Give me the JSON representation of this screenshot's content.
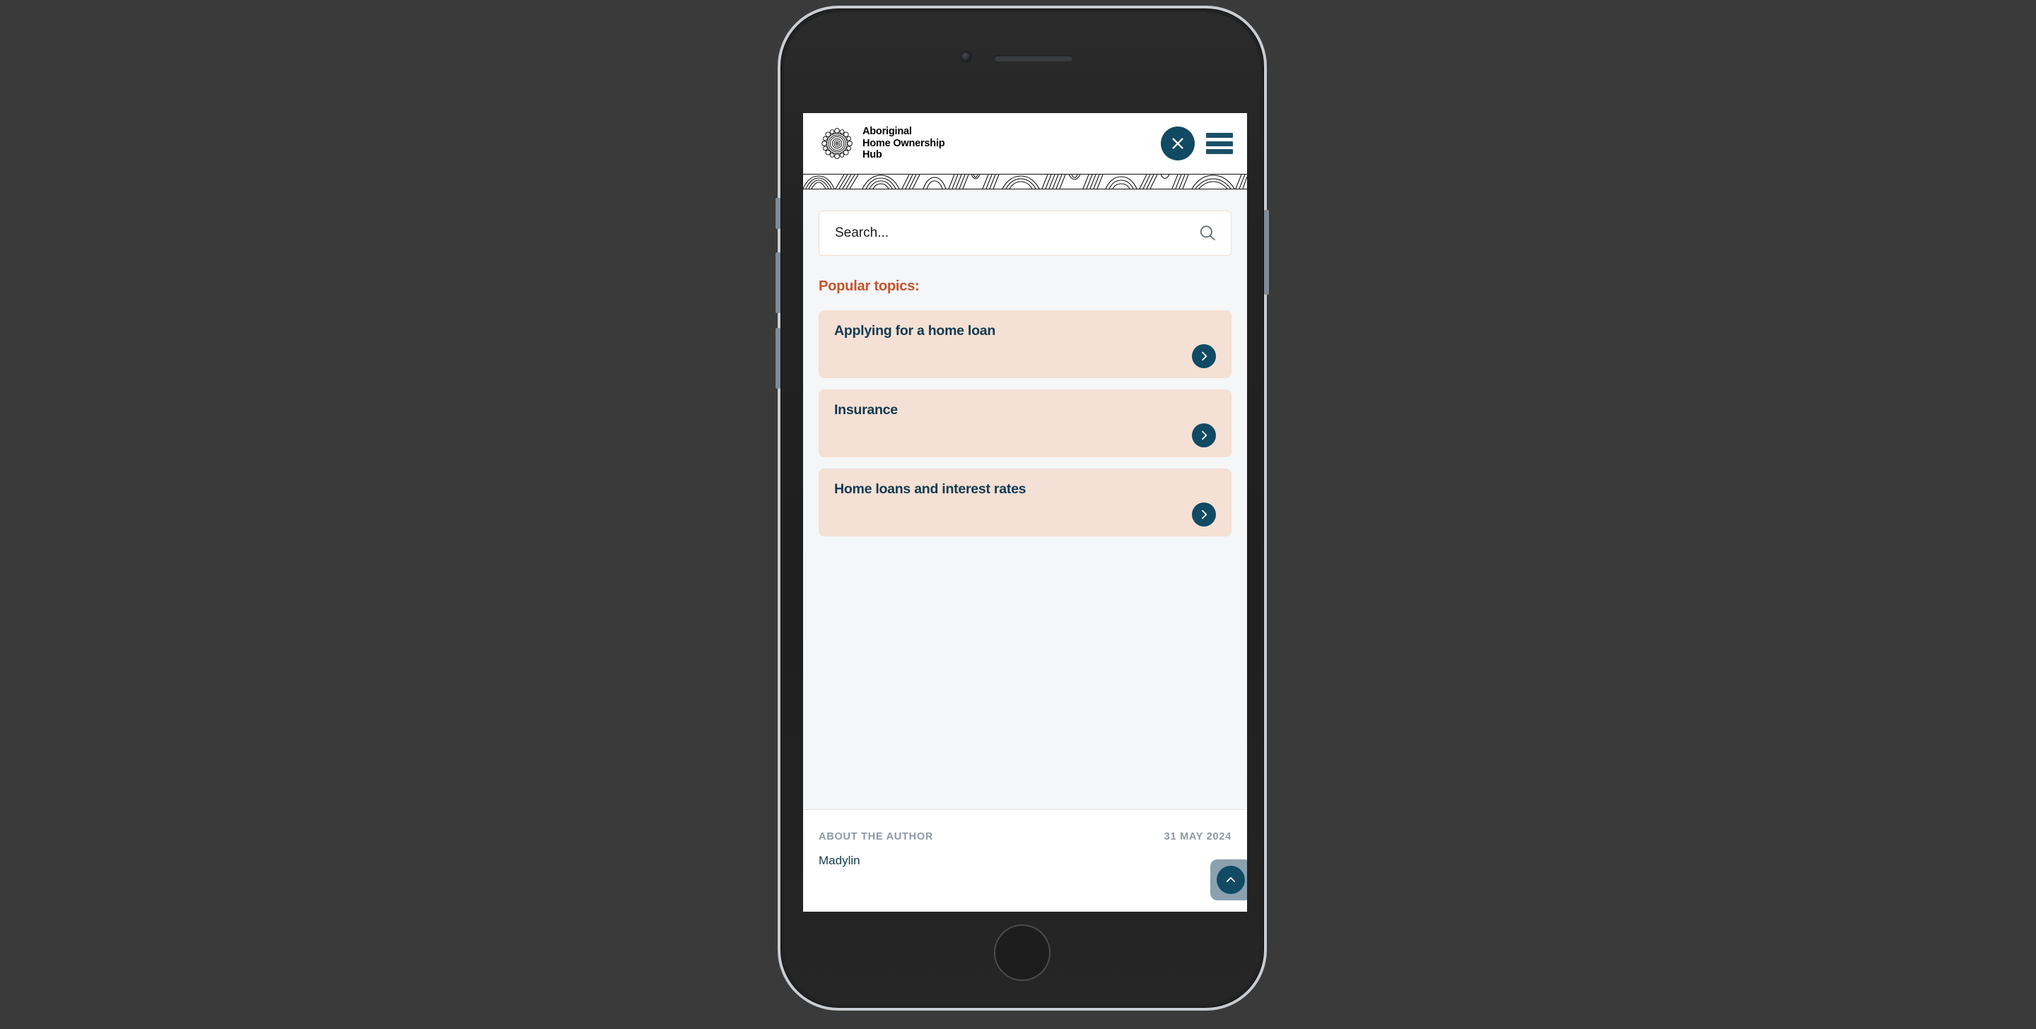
{
  "device": {
    "type": "smartphone-mockup",
    "camera_icon": "camera-dot",
    "speaker_icon": "speaker-grille",
    "home_button_icon": "home-button"
  },
  "header": {
    "logo_icon": "aboriginal-dot-circle-logo",
    "brand_title": "Aboriginal\nHome Ownership\nHub",
    "close_icon": "close-x-icon",
    "menu_icon": "hamburger-menu-icon",
    "pattern_icon": "aboriginal-line-pattern",
    "navy": "#104a63"
  },
  "search": {
    "placeholder": "Search...",
    "value": "",
    "icon": "search-magnifier-icon"
  },
  "popular": {
    "label": "Popular topics:",
    "accent_color": "#c6542a",
    "items": [
      {
        "title": "Applying for a home loan",
        "arrow_icon": "chevron-right-icon"
      },
      {
        "title": "Insurance",
        "arrow_icon": "chevron-right-icon"
      },
      {
        "title": "Home loans and interest rates",
        "arrow_icon": "chevron-right-icon"
      }
    ]
  },
  "footer": {
    "author_kicker": "ABOUT THE AUTHOR",
    "date": "31 MAY 2024",
    "author_name": "Madylin",
    "scroll_top_icon": "chevron-up-icon"
  }
}
